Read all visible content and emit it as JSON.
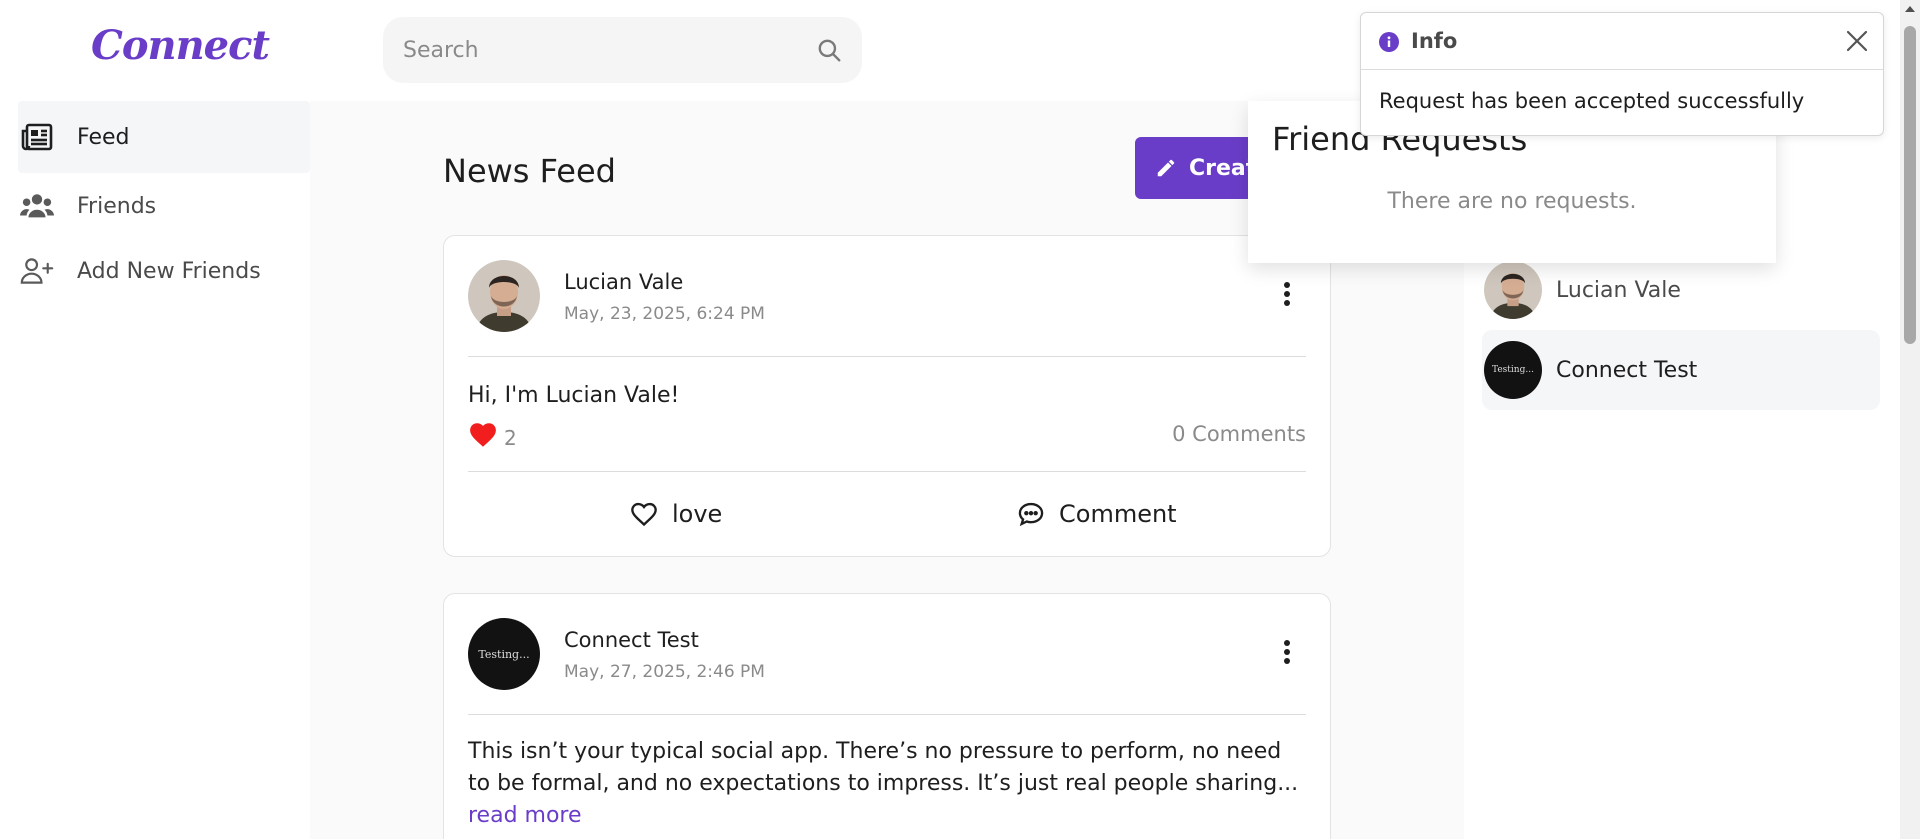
{
  "header": {
    "logo_text": "Connect",
    "search_placeholder": "Search"
  },
  "sidebar": {
    "items": [
      {
        "label": "Feed",
        "icon": "newspaper-icon",
        "active": true
      },
      {
        "label": "Friends",
        "icon": "users-icon",
        "active": false
      },
      {
        "label": "Add New Friends",
        "icon": "user-plus-icon",
        "active": false
      }
    ]
  },
  "main": {
    "title": "News Feed",
    "create_label": "Create Post"
  },
  "posts": [
    {
      "author": "Lucian Vale",
      "date": "May, 23, 2025, 6:24 PM",
      "text": "Hi, I'm Lucian Vale!",
      "likes": "2",
      "comments": "0 Comments",
      "love_label": "love",
      "comment_label": "Comment"
    },
    {
      "author": "Connect Test",
      "date": "May, 27, 2025, 2:46 PM",
      "avatar_text": "Testing...",
      "text": "This isn’t your typical social app. There’s no pressure to perform, no need to be formal, and no expectations to impress. It’s just real people sharing...",
      "read_more": "read more"
    }
  ],
  "friend_requests": {
    "title": "Friend Requests",
    "empty_text": "There are no requests."
  },
  "contacts": [
    {
      "name": "Lucian Vale"
    },
    {
      "name": "Connect Test",
      "avatar_text": "Testing..."
    }
  ],
  "toast": {
    "title": "Info",
    "message": "Request has been accepted successfully"
  },
  "colors": {
    "brand": "#6a3dc8",
    "heart": "#f21d1d"
  }
}
